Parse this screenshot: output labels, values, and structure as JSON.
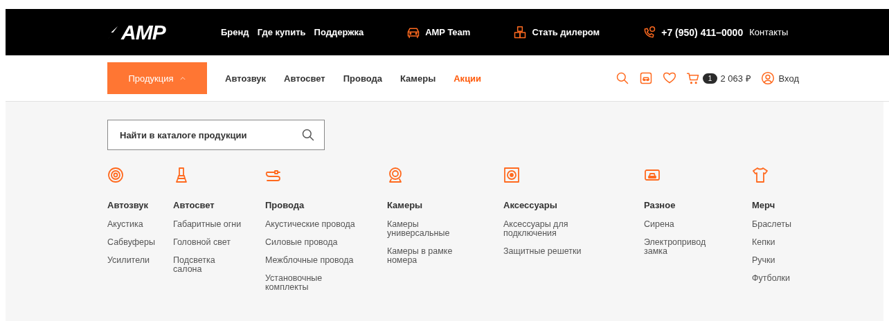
{
  "top_bar": {
    "logo": "AMP",
    "links": [
      "Бренд",
      "Где купить",
      "Поддержка"
    ],
    "team": "AMP Team",
    "dealer": "Стать дилером",
    "phone": "+7 (950) 411–0000",
    "contacts": "Контакты"
  },
  "nav": {
    "products_button": {
      "label": "Продукция",
      "expanded": true
    },
    "links": [
      {
        "label": "Автозвук",
        "accent": false
      },
      {
        "label": "Автосвет",
        "accent": false
      },
      {
        "label": "Провода",
        "accent": false
      },
      {
        "label": "Камеры",
        "accent": false
      },
      {
        "label": "Акции",
        "accent": true
      }
    ],
    "cart_count": "1",
    "cart_total": "2 063 ₽",
    "login": "Вход"
  },
  "catalog": {
    "search": {
      "placeholder": "Найти в каталоге продукции"
    },
    "categories": [
      {
        "title": "Автозвук",
        "items": [
          "Акустика",
          "Сабвуферы",
          "Усилители"
        ]
      },
      {
        "title": "Автосвет",
        "items": [
          "Габаритные огни",
          "Головной свет",
          "Подсветка салона"
        ]
      },
      {
        "title": "Провода",
        "items": [
          "Акустические провода",
          "Силовые провода",
          "Межблочные провода",
          "Установочные комплекты"
        ]
      },
      {
        "title": "Камеры",
        "items": [
          "Камеры универсальные",
          "Камеры в рамке номера"
        ]
      },
      {
        "title": "Аксессуары",
        "items": [
          "Аксессуары для подключения",
          "Защитные решетки"
        ]
      },
      {
        "title": "Разное",
        "items": [
          "Сирена",
          "Электропривод замка"
        ]
      },
      {
        "title": "Мерч",
        "items": [
          "Браслеты",
          "Кепки",
          "Ручки",
          "Футболки"
        ]
      }
    ]
  }
}
